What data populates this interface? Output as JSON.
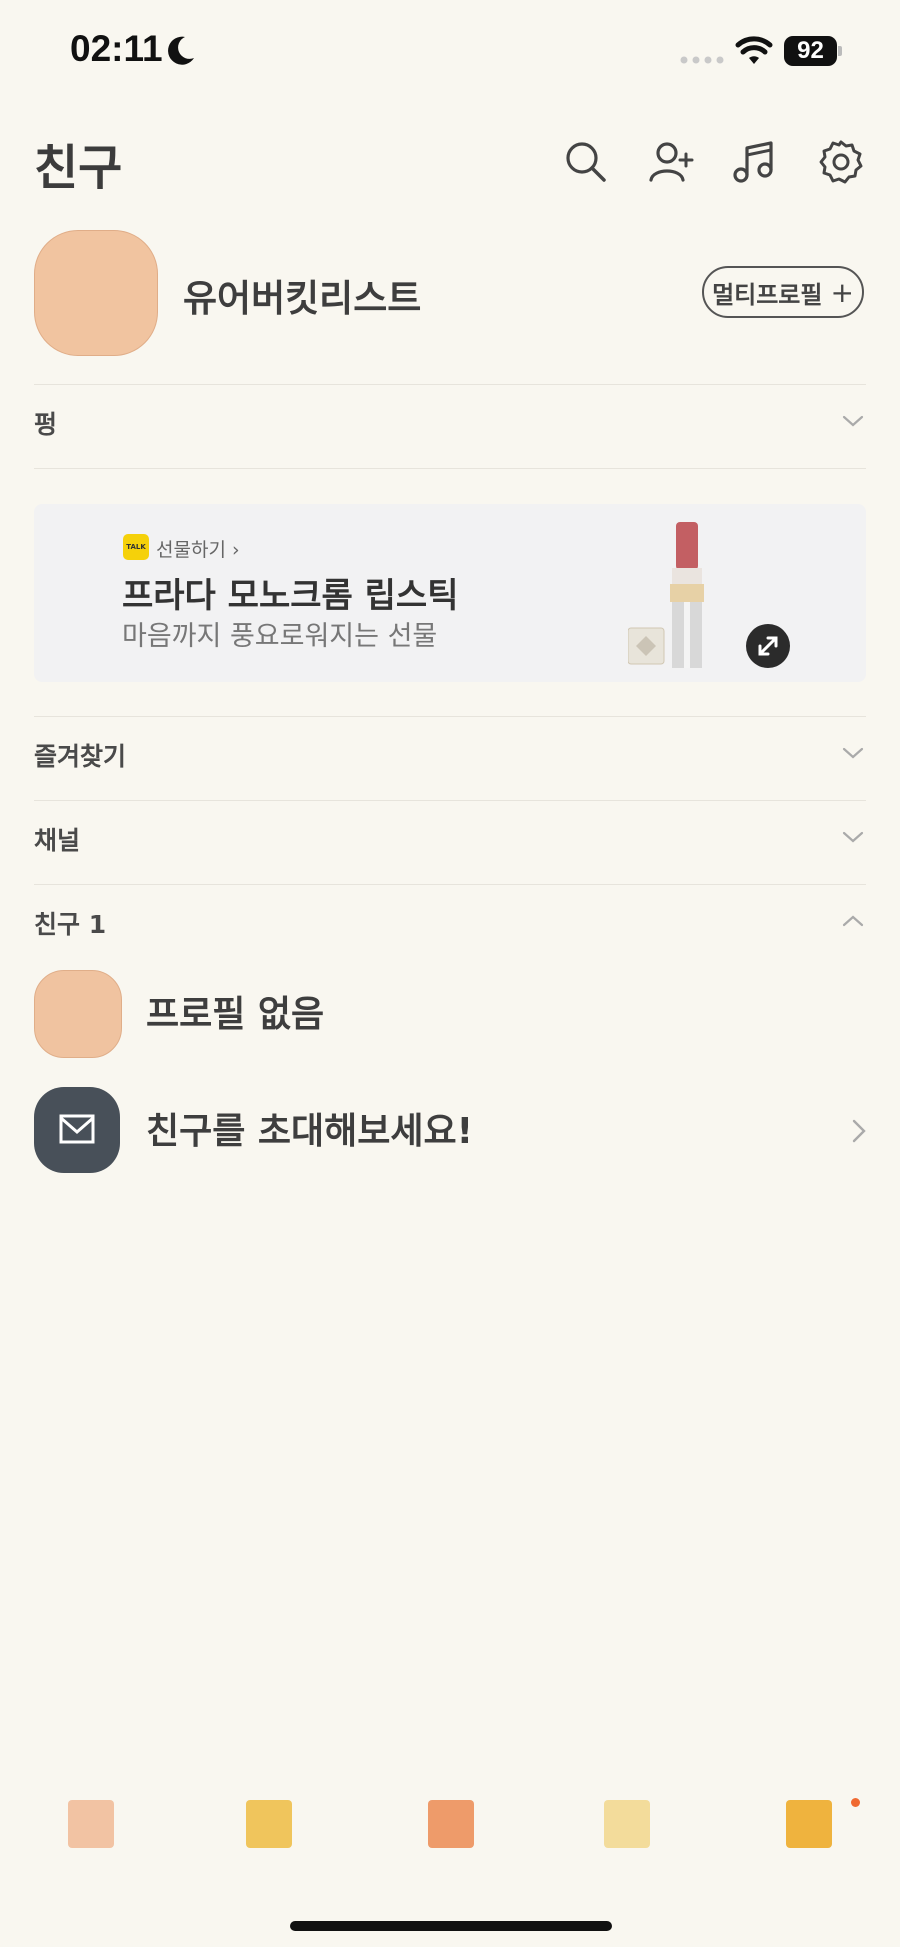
{
  "status_bar": {
    "time": "02:11",
    "battery": "92"
  },
  "header": {
    "title": "친구",
    "icons": [
      "search-icon",
      "add-friend-icon",
      "music-icon",
      "settings-icon"
    ]
  },
  "my_profile": {
    "name": "유어버킷리스트",
    "multi_profile_label": "멀티프로필",
    "multi_profile_plus": "+"
  },
  "sections": {
    "first": "펑",
    "favorites": "즐겨찾기",
    "channels": "채널",
    "friends": "친구 1"
  },
  "banner": {
    "badge": "TALK",
    "category": "선물하기 ›",
    "title": "프라다 모노크롬 립스틱",
    "subtitle": "마음까지 풍요로워지는 선물"
  },
  "friends": [
    {
      "name": "프로필 없음"
    }
  ],
  "invite": {
    "text": "친구를 초대해보세요!"
  },
  "tabs": {
    "colors": [
      "#f2c3a3",
      "#f0c55c",
      "#ee9b6a",
      "#f3dc9b",
      "#efb33e"
    ],
    "badge_color": "#f06a32"
  }
}
